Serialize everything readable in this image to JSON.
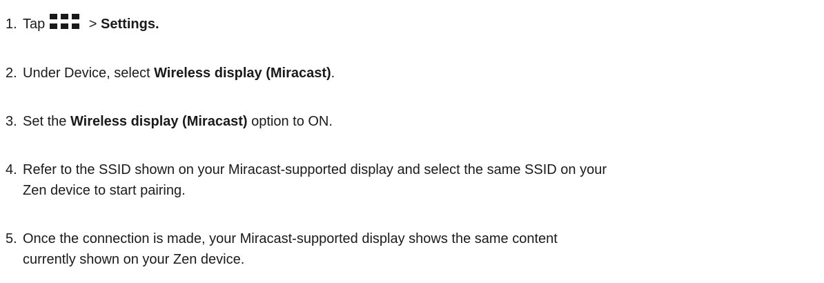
{
  "steps": [
    {
      "number": "1.",
      "pre": "Tap",
      "icon": "apps-grid-icon",
      "mid": " > ",
      "bold": "Settings."
    },
    {
      "number": "2.",
      "pre": "Under Device, select ",
      "bold": "Wireless display (Miracast)",
      "post": "."
    },
    {
      "number": "3.",
      "pre": "Set the ",
      "bold": "Wireless display (Miracast)",
      "post": " option to ON."
    },
    {
      "number": "4.",
      "line1": "Refer to the SSID shown on your Miracast-supported display and select the same SSID on your",
      "line2": "Zen device to start pairing."
    },
    {
      "number": "5.",
      "line1": "Once the connection is made, your Miracast-supported display shows the same content",
      "line2": "currently shown on your Zen device."
    }
  ]
}
